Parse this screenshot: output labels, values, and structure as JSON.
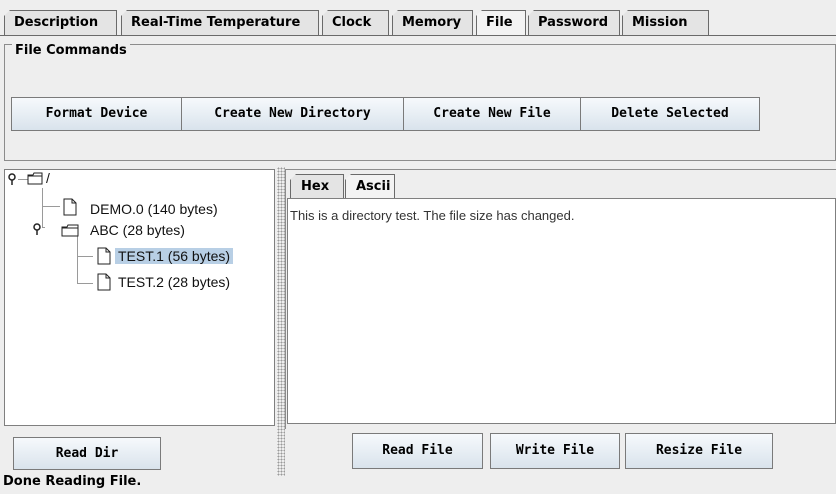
{
  "tabs": [
    {
      "label": "Description",
      "selected": false
    },
    {
      "label": "Real-Time Temperature",
      "selected": false
    },
    {
      "label": "Clock",
      "selected": false
    },
    {
      "label": "Memory",
      "selected": false
    },
    {
      "label": "File",
      "selected": true
    },
    {
      "label": "Password",
      "selected": false
    },
    {
      "label": "Mission",
      "selected": false
    }
  ],
  "file_commands": {
    "title": "File Commands",
    "buttons": [
      "Format Device",
      "Create New Directory",
      "Create New File",
      "Delete Selected"
    ]
  },
  "tree": {
    "root": "/",
    "nodes": [
      {
        "label": "DEMO.0  (140 bytes)",
        "type": "file"
      },
      {
        "label": "ABC  (28 bytes)",
        "type": "folder"
      },
      {
        "label": "TEST.1  (56 bytes)",
        "type": "file",
        "selected": true
      },
      {
        "label": "TEST.2  (28 bytes)",
        "type": "file"
      }
    ]
  },
  "viewer": {
    "tabs": [
      {
        "label": "Hex",
        "selected": false
      },
      {
        "label": "Ascii",
        "selected": true
      }
    ],
    "content": "This is a directory test. The file size has changed."
  },
  "buttons": {
    "read_dir": "Read Dir",
    "read_file": "Read File",
    "write_file": "Write File",
    "resize_file": "Resize File"
  },
  "status": "Done Reading File.",
  "colors": {
    "selection": "#b8cfe5",
    "button_top": "#f6f9fc",
    "button_bottom": "#d9e3ec"
  }
}
